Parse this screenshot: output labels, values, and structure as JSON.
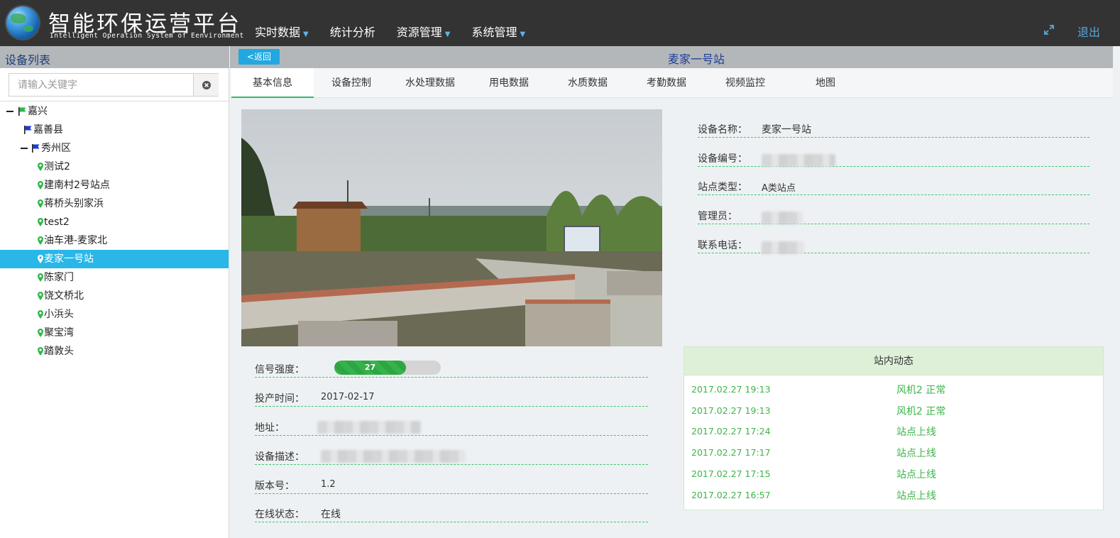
{
  "app": {
    "title": "智能环保运营平台",
    "subtitle": "Intelligent Operation System of Eenvironment"
  },
  "nav": [
    {
      "label": "实时数据",
      "dropdown": true
    },
    {
      "label": "统计分析",
      "dropdown": false
    },
    {
      "label": "资源管理",
      "dropdown": true
    },
    {
      "label": "系统管理",
      "dropdown": true
    }
  ],
  "header": {
    "logout": "退出"
  },
  "sidebar": {
    "title": "设备列表",
    "search_placeholder": "请输入关键字",
    "tree": [
      {
        "label": "嘉兴",
        "kind": "flag-green",
        "expanded": true,
        "level": 0
      },
      {
        "label": "嘉善县",
        "kind": "flag-blue",
        "level": 1
      },
      {
        "label": "秀州区",
        "kind": "flag-blue",
        "expanded": true,
        "level": 1
      },
      {
        "label": "测试2",
        "kind": "pin",
        "level": 2
      },
      {
        "label": "建南村2号站点",
        "kind": "pin",
        "level": 2
      },
      {
        "label": "蒋桥头别家浜",
        "kind": "pin",
        "level": 2
      },
      {
        "label": "test2",
        "kind": "pin",
        "level": 2
      },
      {
        "label": "油车港-麦家北",
        "kind": "pin",
        "level": 2
      },
      {
        "label": "麦家一号站",
        "kind": "pin",
        "level": 2,
        "selected": true
      },
      {
        "label": "陈家门",
        "kind": "pin",
        "level": 2
      },
      {
        "label": "饶文桥北",
        "kind": "pin",
        "level": 2
      },
      {
        "label": "小浜头",
        "kind": "pin",
        "level": 2
      },
      {
        "label": "聚宝湾",
        "kind": "pin",
        "level": 2
      },
      {
        "label": "踏敦头",
        "kind": "pin",
        "level": 2
      }
    ]
  },
  "main": {
    "back_label": "<返回",
    "station_title": "麦家一号站",
    "tabs": [
      "基本信息",
      "设备控制",
      "水处理数据",
      "用电数据",
      "水质数据",
      "考勤数据",
      "视频监控",
      "地图"
    ],
    "active_tab": 0
  },
  "left_info": {
    "signal": {
      "label": "信号强度：",
      "value": 27,
      "max": 40
    },
    "commission_date": {
      "label": "投产时间：",
      "value": "2017-02-17"
    },
    "address": {
      "label": "地址："
    },
    "description": {
      "label": "设备描述："
    },
    "version": {
      "label": "版本号：",
      "value": "1.2"
    },
    "online_status": {
      "label": "在线状态：",
      "value": "在线"
    }
  },
  "right_info": {
    "device_name": {
      "label": "设备名称：",
      "value": "麦家一号站"
    },
    "device_code": {
      "label": "设备编号："
    },
    "station_type": {
      "label": "站点类型：",
      "value": "A类站点"
    },
    "admin": {
      "label": "管理员："
    },
    "phone": {
      "label": "联系电话："
    }
  },
  "events": {
    "title": "站内动态",
    "items": [
      {
        "time": "2017.02.27 19:13",
        "msg": "风机2 正常"
      },
      {
        "time": "2017.02.27 19:13",
        "msg": "风机2 正常"
      },
      {
        "time": "2017.02.27 17:24",
        "msg": "站点上线"
      },
      {
        "time": "2017.02.27 17:17",
        "msg": "站点上线"
      },
      {
        "time": "2017.02.27 17:15",
        "msg": "站点上线"
      },
      {
        "time": "2017.02.27 16:57",
        "msg": "站点上线"
      }
    ]
  },
  "colors": {
    "topbar": "#333333",
    "accent_blue": "#28b7e8",
    "accent_green": "#3cb54a",
    "title_blue": "#1b3d9a"
  }
}
